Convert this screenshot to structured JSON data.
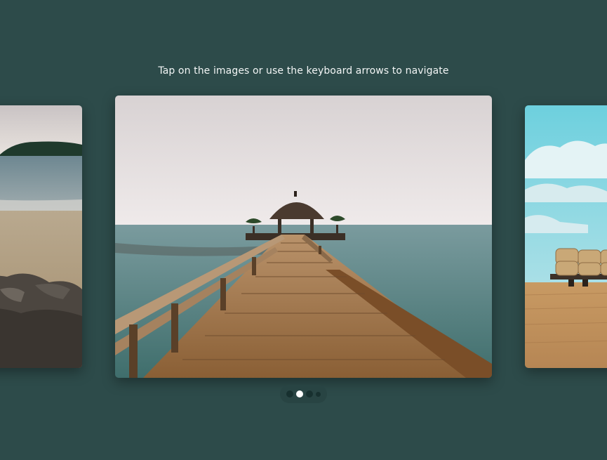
{
  "carousel": {
    "instructions": "Tap on the images or use the keyboard arrows to navigate",
    "slides": [
      {
        "name": "beach-rocks",
        "position": "previous"
      },
      {
        "name": "pier-hut",
        "position": "current"
      },
      {
        "name": "hay-bales-field",
        "position": "next"
      }
    ],
    "pagination": {
      "count": 4,
      "active_index": 1
    }
  },
  "colors": {
    "background": "#2d4b4a",
    "dots_track": "#284443",
    "dot_inactive": "#17302f",
    "dot_active": "#ffffff",
    "text": "#f2f5f5"
  }
}
